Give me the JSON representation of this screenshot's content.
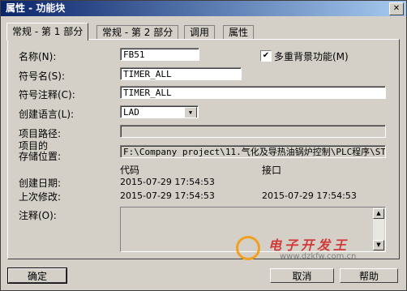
{
  "window": {
    "title": "属性 - 功能块",
    "close_glyph": "✕"
  },
  "tabs": [
    {
      "label": "常规 - 第 1 部分",
      "active": true
    },
    {
      "label": "常规 - 第 2 部分",
      "active": false
    },
    {
      "label": "调用",
      "active": false
    },
    {
      "label": "属性",
      "active": false
    }
  ],
  "form": {
    "name_label": "名称(N):",
    "name_value": "FB51",
    "multi_instance_label": "多重背景功能(M)",
    "multi_instance_checked": true,
    "check_glyph": "✔",
    "symbol_label": "符号名(S):",
    "symbol_value": "TIMER_ALL",
    "symbol_comment_label": "符号注释(C):",
    "symbol_comment_value": "TIMER_ALL",
    "language_label": "创建语言(L):",
    "language_value": "LAD",
    "project_path_label": "项目路径:",
    "project_path_value": "",
    "storage_label_1": "项目的",
    "storage_label_2": "存储位置:",
    "storage_value": "F:\\Company project\\11.气化及导热油锅炉控制\\PLC程序\\STE",
    "col_code": "代码",
    "col_interface": "接口",
    "created_label": "创建日期:",
    "created_code": "2015-07-29 17:54:53",
    "modified_label": "上次修改:",
    "modified_code": "2015-07-29 17:54:53",
    "modified_interface": "2015-07-29 17:54:53",
    "comment_label": "注释(O):"
  },
  "buttons": {
    "ok": "确定",
    "cancel": "取消",
    "help": "帮助"
  },
  "watermark": {
    "title": "电子开发王",
    "url": "www.dzkfw.com.cn"
  },
  "colors": {
    "title_start": "#0a246a",
    "title_end": "#a6caf0",
    "face": "#d4d0c8"
  }
}
